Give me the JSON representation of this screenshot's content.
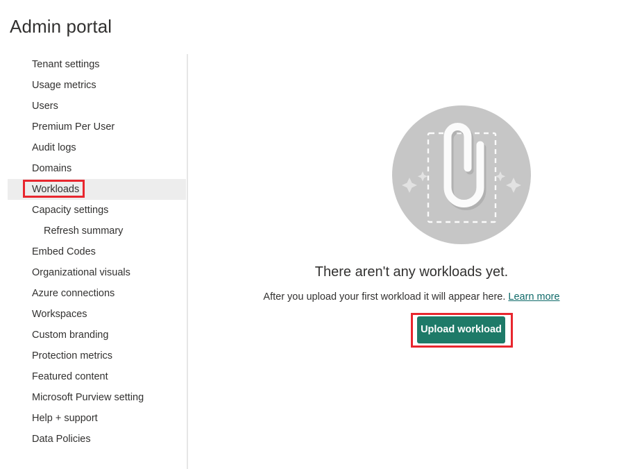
{
  "header": {
    "title": "Admin portal"
  },
  "sidebar": {
    "items": [
      {
        "label": "Tenant settings",
        "sub": false,
        "selected": false
      },
      {
        "label": "Usage metrics",
        "sub": false,
        "selected": false
      },
      {
        "label": "Users",
        "sub": false,
        "selected": false
      },
      {
        "label": "Premium Per User",
        "sub": false,
        "selected": false
      },
      {
        "label": "Audit logs",
        "sub": false,
        "selected": false
      },
      {
        "label": "Domains",
        "sub": false,
        "selected": false
      },
      {
        "label": "Workloads",
        "sub": false,
        "selected": true
      },
      {
        "label": "Capacity settings",
        "sub": false,
        "selected": false
      },
      {
        "label": "Refresh summary",
        "sub": true,
        "selected": false
      },
      {
        "label": "Embed Codes",
        "sub": false,
        "selected": false
      },
      {
        "label": "Organizational visuals",
        "sub": false,
        "selected": false
      },
      {
        "label": "Azure connections",
        "sub": false,
        "selected": false
      },
      {
        "label": "Workspaces",
        "sub": false,
        "selected": false
      },
      {
        "label": "Custom branding",
        "sub": false,
        "selected": false
      },
      {
        "label": "Protection metrics",
        "sub": false,
        "selected": false
      },
      {
        "label": "Featured content",
        "sub": false,
        "selected": false
      },
      {
        "label": "Microsoft Purview setting",
        "sub": false,
        "selected": false
      },
      {
        "label": "Help + support",
        "sub": false,
        "selected": false
      },
      {
        "label": "Data Policies",
        "sub": false,
        "selected": false
      }
    ]
  },
  "main": {
    "empty_state": {
      "illustration_icon": "paperclip-upload-icon",
      "heading": "There aren't any workloads yet.",
      "description": "After you upload your first workload it will appear here.",
      "learn_more_label": "Learn more",
      "upload_button_label": "Upload workload"
    }
  },
  "annotations": [
    {
      "name": "workloads-highlight",
      "target": "Workloads"
    },
    {
      "name": "upload-workload-highlight",
      "target": "Upload workload"
    }
  ],
  "colors": {
    "accent_button": "#1e7a68",
    "annotation_red": "#e8262e",
    "selected_row": "#ededed",
    "link": "#0f6a69",
    "illustration_circle": "#c6c6c6",
    "text": "#323130"
  }
}
